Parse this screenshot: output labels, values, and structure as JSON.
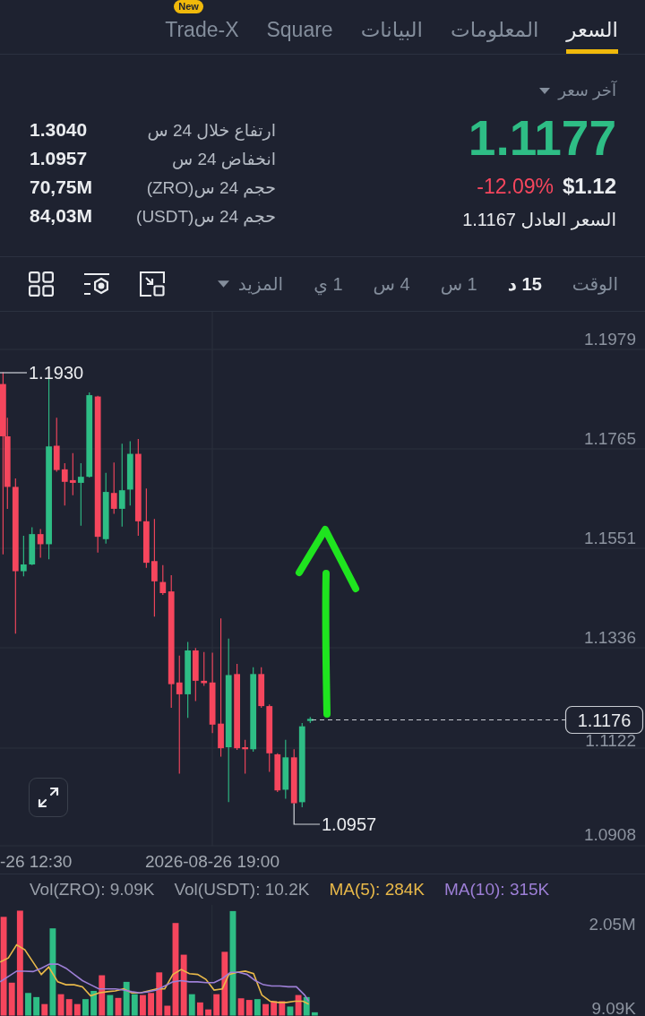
{
  "tabs": [
    {
      "label": "السعر",
      "selected": true
    },
    {
      "label": "المعلومات",
      "selected": false
    },
    {
      "label": "البيانات",
      "selected": false
    },
    {
      "label": "Square",
      "selected": false
    },
    {
      "badge": "New",
      "label": "Trade-X",
      "selected": false
    }
  ],
  "quote": {
    "price_type": "آخر سعر",
    "last_price": "1.1177",
    "usd_price": "$1.12",
    "change": "-12.09%",
    "fair_price": "السعر العادل 1.1167"
  },
  "stats": [
    {
      "label": "ارتفاع خلال 24 س",
      "value": "1.3040"
    },
    {
      "label": "انخفاض 24 س",
      "value": "1.0957"
    },
    {
      "label": "حجم 24 س(ZRO)",
      "value": "70,75M"
    },
    {
      "label": "حجم 24 س(USDT)",
      "value": "84,03M"
    }
  ],
  "intervals": [
    {
      "label": "الوقت",
      "kind": "option",
      "selected": false
    },
    {
      "label": "15 د",
      "kind": "option",
      "selected": true
    },
    {
      "label": "1 س",
      "kind": "option",
      "selected": false
    },
    {
      "label": "4 س",
      "kind": "option",
      "selected": false
    },
    {
      "label": "1 ي",
      "kind": "option",
      "selected": false
    },
    {
      "label": "المزيد",
      "kind": "dropdown",
      "selected": false
    }
  ],
  "chart": {
    "price_axis": [
      "1.1979",
      "1.1765",
      "1.1551",
      "1.1336",
      "1.1122",
      "1.0908"
    ],
    "high_label": "1.1930",
    "low_label": "1.0957",
    "current_price": "1.1176",
    "time_axis": [
      "2026-08-26 19:00",
      "-26 12:30"
    ]
  },
  "volume": {
    "legend": [
      {
        "text": "MA(10): 315K",
        "color": "#9d7fd6"
      },
      {
        "text": "MA(5): 284K",
        "color": "#e9b949"
      },
      {
        "text": "Vol(USDT): 10.2K",
        "color": "#9aa0aa"
      },
      {
        "text": "Vol(ZRO): 9.09K",
        "color": "#9aa0aa"
      }
    ],
    "axis": [
      "2.05M",
      "9.09K"
    ]
  }
}
